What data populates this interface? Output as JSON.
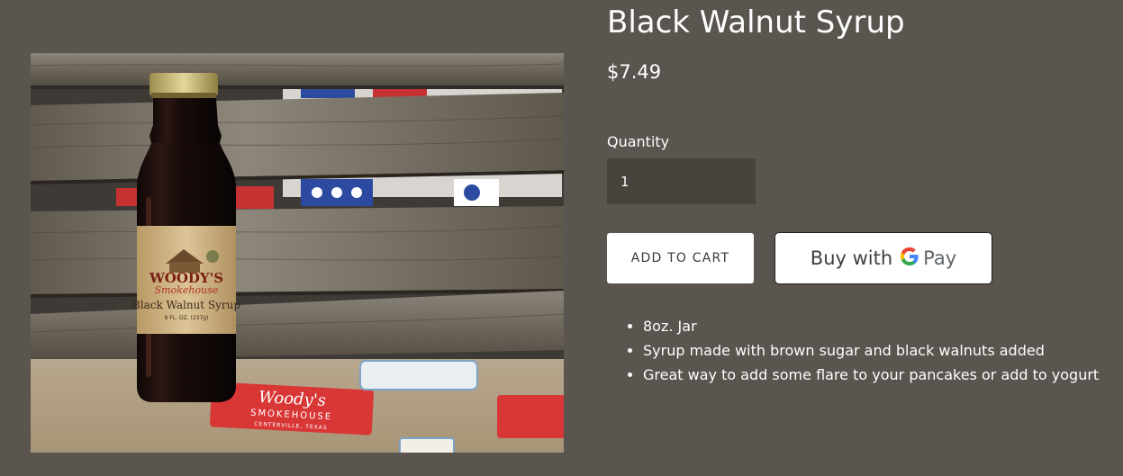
{
  "product": {
    "title": "Black Walnut Syrup",
    "price": "$7.49",
    "image_alt": "Black Walnut Syrup bottle",
    "label": {
      "brand_top": "WOODY'S",
      "brand_bottom": "Smokehouse",
      "product_name": "Black Walnut Syrup",
      "size": "8 FL. OZ. (237g)"
    },
    "sticker": {
      "line1": "Woody's",
      "line2": "SMOKEHOUSE",
      "line3": "CENTERVILLE, TEXAS"
    }
  },
  "quantity": {
    "label": "Quantity",
    "value": "1"
  },
  "actions": {
    "add_to_cart": "ADD TO CART",
    "buy_with": "Buy with",
    "pay": "Pay"
  },
  "features": [
    "8oz. Jar",
    "Syrup made with brown sugar and black walnuts added",
    "Great way to add some flare to your pancakes or add to yogurt"
  ],
  "colors": {
    "page_background": "#5a554e",
    "input_background": "#47433d",
    "button_background": "#ffffff",
    "google_blue": "#4285f4",
    "google_red": "#ea4335",
    "google_yellow": "#fbbc05",
    "google_green": "#34a853"
  }
}
